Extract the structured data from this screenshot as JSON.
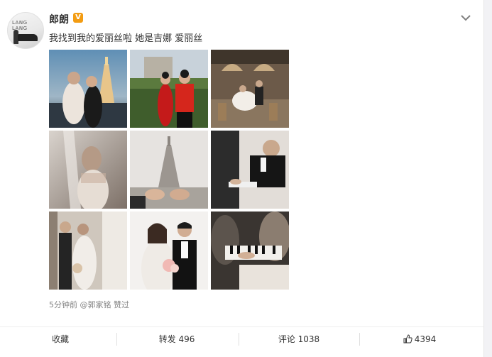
{
  "post": {
    "username": "郎朗",
    "verified_badge": "V",
    "avatar_text": "LANG LANG",
    "text": "我找到我的爱丽丝啦 她是吉娜 爱丽丝",
    "time_ago": "5分钟前",
    "liked_by": "@郭家铭",
    "liked_label": "赞过"
  },
  "photos": [
    {
      "name": "photo-eiffel-night",
      "desc": "couple at Eiffel Tower at dusk"
    },
    {
      "name": "photo-arc-qipao",
      "desc": "couple in red qipao near Arc de Triomphe"
    },
    {
      "name": "photo-cafe",
      "desc": "couple at Paris cafe"
    },
    {
      "name": "photo-veil",
      "desc": "bride behind veil"
    },
    {
      "name": "photo-eiffel-hands",
      "desc": "hands with Eiffel Tower"
    },
    {
      "name": "photo-piano-groom",
      "desc": "groom playing piano"
    },
    {
      "name": "photo-bride-window",
      "desc": "bride and groom by window"
    },
    {
      "name": "photo-couple-portrait",
      "desc": "couple portrait with bouquet"
    },
    {
      "name": "photo-piano-keys",
      "desc": "couple at piano keys"
    }
  ],
  "actions": {
    "favorite": "收藏",
    "repost": "转发 496",
    "comment": "评论 1038",
    "like": "4394"
  },
  "icons": {
    "menu": "chevron-down-icon",
    "like": "thumbs-up-icon",
    "verified": "verified-badge-icon"
  },
  "colors": {
    "text": "#333333",
    "meta": "#808080",
    "badge": "#f39c12",
    "background": "#f2f2f5"
  }
}
